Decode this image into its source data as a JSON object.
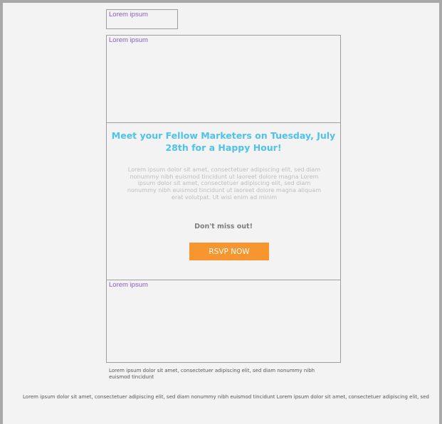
{
  "header": {
    "logo_placeholder": "Lorem ipsum"
  },
  "hero": {
    "placeholder": "Lorem ipsum"
  },
  "content": {
    "headline": "Meet your Fellow Marketers on Tuesday, July 28th for a Happy Hour!",
    "body": "Lorem ipsum dolor sit amet, consectetuer adipiscing elit, sed diam nonummy nibh euismod tincidunt ut laoreet dolore magna Lorem ipsum dolor sit amet, consectetuer adipiscing elit, sed diam nonummy nibh euismod tincidunt ut laoreet dolore magna aliquam erat volutpat. Ut wisi enim ad minim",
    "cta_intro": "Don't miss out!",
    "cta_button": "RSVP NOW"
  },
  "lower": {
    "placeholder": "Lorem ipsum"
  },
  "footer": {
    "line_1": "Lorem ipsum dolor sit amet, consectetuer adipiscing elit, sed diam nonummy nibh euismod tincidunt",
    "line_2": "Lorem ipsum dolor sit amet, consectetuer adipiscing elit, sed diam nonummy nibh euismod tincidunt Lorem ipsum dolor sit amet, consectetuer adipiscing elit, sed"
  },
  "colors": {
    "headline": "#4dc2ea",
    "cta_button": "#f7952f",
    "placeholder_text": "#8a5cc4",
    "wireframe_border": "#9e9e9e"
  }
}
